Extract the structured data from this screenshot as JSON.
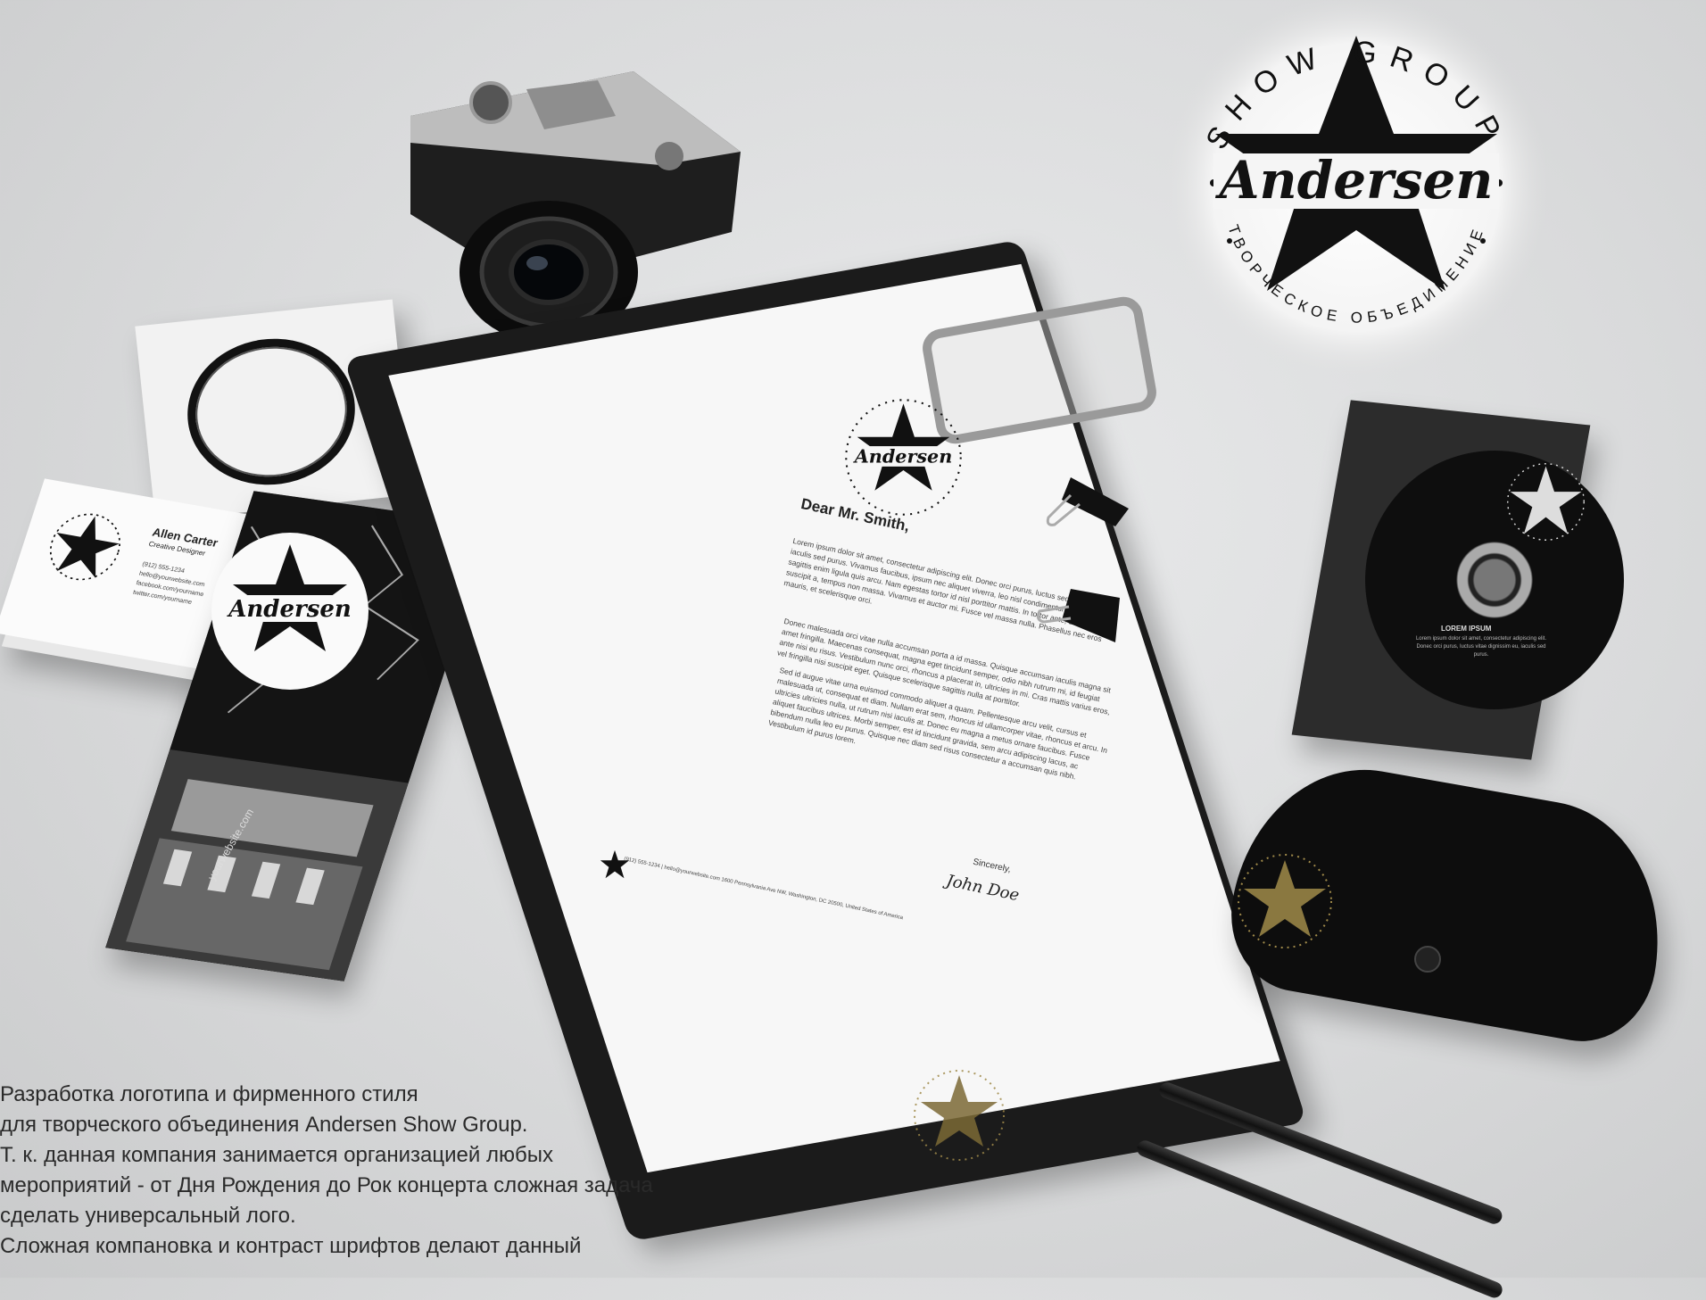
{
  "brand": {
    "arc_top": "SHOW GROUP",
    "script_name": "Andersen",
    "arc_bottom": "ТВОРЧЕСКОЕ ОБЪЕДИНЕНИЕ"
  },
  "business_card": {
    "name": "Allen Carter",
    "role": "Creative Designer",
    "lines": [
      "(912) 555-1234",
      "hello@yourwebsite.com",
      "facebook.com/yourname",
      "twitter.com/yourname"
    ]
  },
  "flyer": {
    "url": "yourwebsite.com"
  },
  "letter": {
    "greeting": "Dear Mr. Smith,",
    "paragraph1": "Lorem ipsum dolor sit amet, consectetur adipiscing elit. Donec orci purus, luctus sed dignissim eu, iaculis sed purus. Vivamus faucibus, ipsum nec aliquet viverra, leo nisl condimentum ligula, sit amet sagittis enim ligula quis arcu. Nam egestas tortor id nisl porttitor mattis. In tortor ante, ultricies in suscipit a, tempus non massa. Vivamus et auctor mi. Fusce vel massa nulla. Phasellus nec eros mauris, et scelerisque orci.",
    "paragraph2": "Donec malesuada orci vitae nulla accumsan porta a id massa. Quisque accumsan iaculis magna sit amet fringilla. Maecenas consequat, magna eget tincidunt semper, odio nibh rutrum mi, id feugiat ante nisi eu risus. Vestibulum nunc orci, rhoncus a placerat in, ultricies in mi. Cras mattis varius eros, vel fringilla nisi suscipit eget. Quisque scelerisque sagittis nulla at porttitor.",
    "paragraph3": "Sed id augue vitae urna euismod commodo aliquet a quam. Pellentesque arcu velit, cursus et malesuada ut, consequat et diam. Nullam erat sem, rhoncus id ullamcorper vitae, rhoncus et arcu. In ultricies ultricies nulla, ut rutrum nisi iaculis at. Donec eu magna a metus ornare faucibus. Fusce aliquet faucibus ultrices. Morbi semper, est id tincidunt gravida, sem arcu adipiscing lacus, ac bibendum nulla leo eu purus. Quisque nec diam sed risus consectetur a accumsan quis nibh. Vestibulum id purus lorem.",
    "closing": "Sincerely,",
    "signature": "John Doe",
    "footer": "(912) 555-1234 | hello@yourwebsite.com 1600 Pennsylvania Ave NW, Washington, DC 20500, United States of America"
  },
  "cd": {
    "title": "LOREM IPSUM",
    "text": "Lorem ipsum dolor sit amet, consectetur adipiscing elit. Donec orci purus, luctus vitae dignissim eu, iaculis sed purus."
  },
  "caption": {
    "lines": [
      "Разработка логотипа и фирменного стиля",
      "для творческого объединения Andersen Show Group.",
      "Т. к. данная компания занимается организацией любых",
      "мероприятий - от Дня Рождения до Рок концерта сложная задача",
      "сделать универсальный лого.",
      "Сложная компановка и контраст шрифтов делают данный"
    ]
  },
  "colors": {
    "ink": "#111111",
    "paper": "#f7f7f7",
    "gold": "#a08a4a",
    "background": "#dcdddd"
  }
}
